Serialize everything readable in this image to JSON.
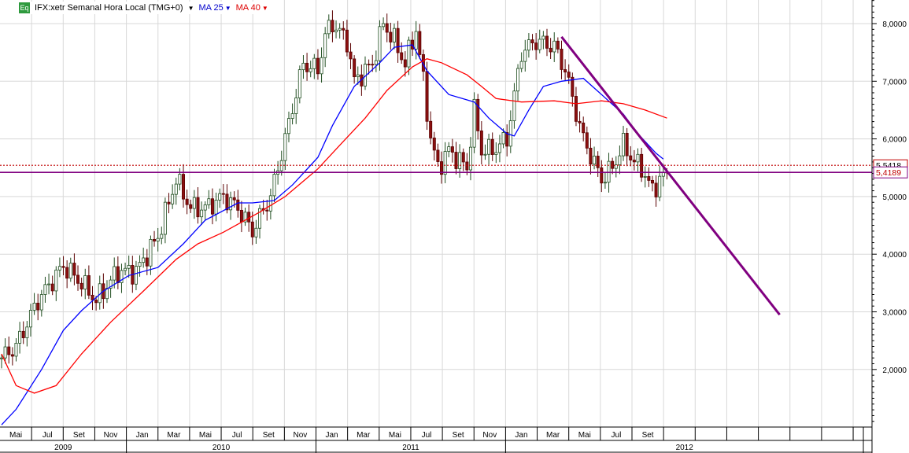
{
  "chart_data": {
    "type": "candlestick",
    "title": "IFX:xetr Semanal Hora Local (TMG+0)",
    "symbol_badge": "Eq",
    "legend": [
      {
        "label": "MA 25",
        "color": "#0000ff"
      },
      {
        "label": "MA 40",
        "color": "#ff0000"
      }
    ],
    "ylim": [
      1.0,
      8.41
    ],
    "y_ticks": [
      2,
      3,
      4,
      5,
      6,
      7,
      8
    ],
    "y_tick_labels": [
      "2,0000",
      "3,0000",
      "4,0000",
      "5,0000",
      "6,0000",
      "7,0000",
      "8,0000"
    ],
    "x_unit": "week index from start (weekly candles)",
    "month_labels": [
      "Mai",
      "Jul",
      "Set",
      "Nov",
      "Jan",
      "Mar",
      "Mai",
      "Jul",
      "Set",
      "Nov",
      "Jan",
      "Mar",
      "Mai",
      "Jul",
      "Set",
      "Nov",
      "Jan",
      "Mar",
      "Mai",
      "Jul",
      "Set",
      "",
      "",
      "",
      "",
      "",
      "",
      ""
    ],
    "year_labels": [
      {
        "label": "2009",
        "from_month_cell": 0,
        "to_month_cell": 4
      },
      {
        "label": "2010",
        "from_month_cell": 4,
        "to_month_cell": 10
      },
      {
        "label": "2011",
        "from_month_cell": 10,
        "to_month_cell": 16
      },
      {
        "label": "2012",
        "from_month_cell": 16,
        "to_month_cell": 28
      }
    ],
    "close_path": [
      [
        0,
        2.2
      ],
      [
        4,
        2.4
      ],
      [
        10,
        3.2
      ],
      [
        17,
        3.8
      ],
      [
        22,
        3.5
      ],
      [
        26,
        3.2
      ],
      [
        32,
        3.7
      ],
      [
        37,
        3.7
      ],
      [
        43,
        4.3
      ],
      [
        48,
        5.3
      ],
      [
        52,
        4.8
      ],
      [
        56,
        4.8
      ],
      [
        61,
        5.0
      ],
      [
        65,
        4.8
      ],
      [
        69,
        4.4
      ],
      [
        74,
        5.0
      ],
      [
        78,
        6.0
      ],
      [
        81,
        6.8
      ],
      [
        83,
        7.3
      ],
      [
        87,
        7.2
      ],
      [
        89,
        7.8
      ],
      [
        91,
        8.0
      ],
      [
        95,
        7.7
      ],
      [
        97,
        7.0
      ],
      [
        102,
        7.3
      ],
      [
        105,
        8.0
      ],
      [
        108,
        7.7
      ],
      [
        111,
        7.3
      ],
      [
        114,
        7.9
      ],
      [
        116,
        7.0
      ],
      [
        118,
        6.0
      ],
      [
        120,
        5.5
      ],
      [
        123,
        5.8
      ],
      [
        128,
        5.5
      ],
      [
        130,
        6.5
      ],
      [
        132,
        5.8
      ],
      [
        135,
        5.8
      ],
      [
        139,
        6.0
      ],
      [
        143,
        7.5
      ],
      [
        147,
        7.7
      ],
      [
        152,
        7.6
      ],
      [
        155,
        7.2
      ],
      [
        157,
        6.7
      ],
      [
        160,
        6.0
      ],
      [
        165,
        5.3
      ],
      [
        168,
        5.5
      ],
      [
        171,
        5.9
      ],
      [
        174,
        5.6
      ],
      [
        176,
        5.5
      ],
      [
        179,
        5.1
      ],
      [
        181,
        5.3
      ],
      [
        183,
        5.42
      ]
    ],
    "series": [
      {
        "name": "MA 25",
        "color": "#0000ff",
        "points": [
          [
            0,
            1.04
          ],
          [
            4,
            1.31
          ],
          [
            11,
            2.0
          ],
          [
            17,
            2.68
          ],
          [
            22,
            3.02
          ],
          [
            28,
            3.36
          ],
          [
            35,
            3.63
          ],
          [
            43,
            3.77
          ],
          [
            50,
            4.18
          ],
          [
            56,
            4.59
          ],
          [
            65,
            4.89
          ],
          [
            69,
            4.89
          ],
          [
            75,
            4.93
          ],
          [
            80,
            5.2
          ],
          [
            87,
            5.68
          ],
          [
            91,
            6.23
          ],
          [
            97,
            6.91
          ],
          [
            104,
            7.32
          ],
          [
            108,
            7.59
          ],
          [
            113,
            7.63
          ],
          [
            117,
            7.18
          ],
          [
            123,
            6.77
          ],
          [
            130,
            6.64
          ],
          [
            134,
            6.36
          ],
          [
            139,
            6.09
          ],
          [
            141,
            6.05
          ],
          [
            145,
            6.5
          ],
          [
            149,
            6.91
          ],
          [
            154,
            7.0
          ],
          [
            160,
            7.05
          ],
          [
            165,
            6.77
          ],
          [
            171,
            6.43
          ],
          [
            175,
            6.09
          ],
          [
            180,
            5.75
          ],
          [
            182,
            5.65
          ]
        ]
      },
      {
        "name": "MA 40",
        "color": "#ff0000",
        "points": [
          [
            0,
            2.27
          ],
          [
            4,
            1.72
          ],
          [
            9,
            1.59
          ],
          [
            15,
            1.72
          ],
          [
            22,
            2.27
          ],
          [
            30,
            2.82
          ],
          [
            39,
            3.36
          ],
          [
            48,
            3.91
          ],
          [
            54,
            4.18
          ],
          [
            61,
            4.38
          ],
          [
            65,
            4.52
          ],
          [
            71,
            4.73
          ],
          [
            78,
            5.0
          ],
          [
            87,
            5.48
          ],
          [
            93,
            5.89
          ],
          [
            100,
            6.36
          ],
          [
            106,
            6.84
          ],
          [
            113,
            7.25
          ],
          [
            117,
            7.39
          ],
          [
            121,
            7.32
          ],
          [
            128,
            7.11
          ],
          [
            132,
            6.91
          ],
          [
            136,
            6.7
          ],
          [
            143,
            6.64
          ],
          [
            152,
            6.66
          ],
          [
            158,
            6.61
          ],
          [
            165,
            6.66
          ],
          [
            171,
            6.61
          ],
          [
            177,
            6.5
          ],
          [
            183,
            6.36
          ]
        ]
      }
    ],
    "trendline": {
      "color": "#800080",
      "from": [
        154,
        7.77
      ],
      "to": [
        214,
        2.95
      ]
    },
    "horizontal_lines": [
      {
        "value": 5.4189,
        "label": "5,4189",
        "style": "solid",
        "color": "#800080"
      },
      {
        "value": 5.5418,
        "label": "5,5418",
        "style": "dotted",
        "color": "#c00000"
      }
    ]
  }
}
